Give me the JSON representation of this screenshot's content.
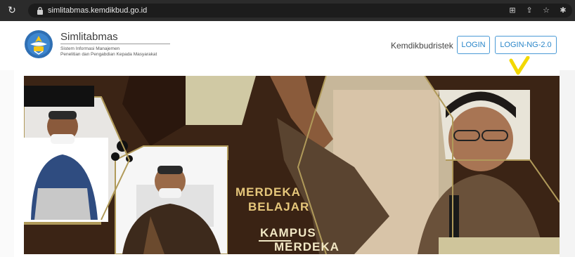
{
  "browser": {
    "url": "simlitabmas.kemdikbud.go.id"
  },
  "header": {
    "brand": "Simlitabmas",
    "subtitle_line1": "Sistem Informasi Manajemen",
    "subtitle_line2": "Penelitian dan Pengabdian Kepada Masyarakat",
    "nav_text": "Kemdikbudristek",
    "login_label": "LOGIN",
    "login_ng_label": "LOGIN-NG-2.0"
  },
  "banner": {
    "line1": "MERDEKA",
    "line2": "BELAJAR",
    "line3": "KAMPUS",
    "line4": "MERDEKA"
  },
  "colors": {
    "chrome": "#2b2b2b",
    "accent": "#2a86c9",
    "banner_brown": "#3a2314",
    "banner_gold": "#e6c77b",
    "check_yellow": "#f2d800"
  }
}
